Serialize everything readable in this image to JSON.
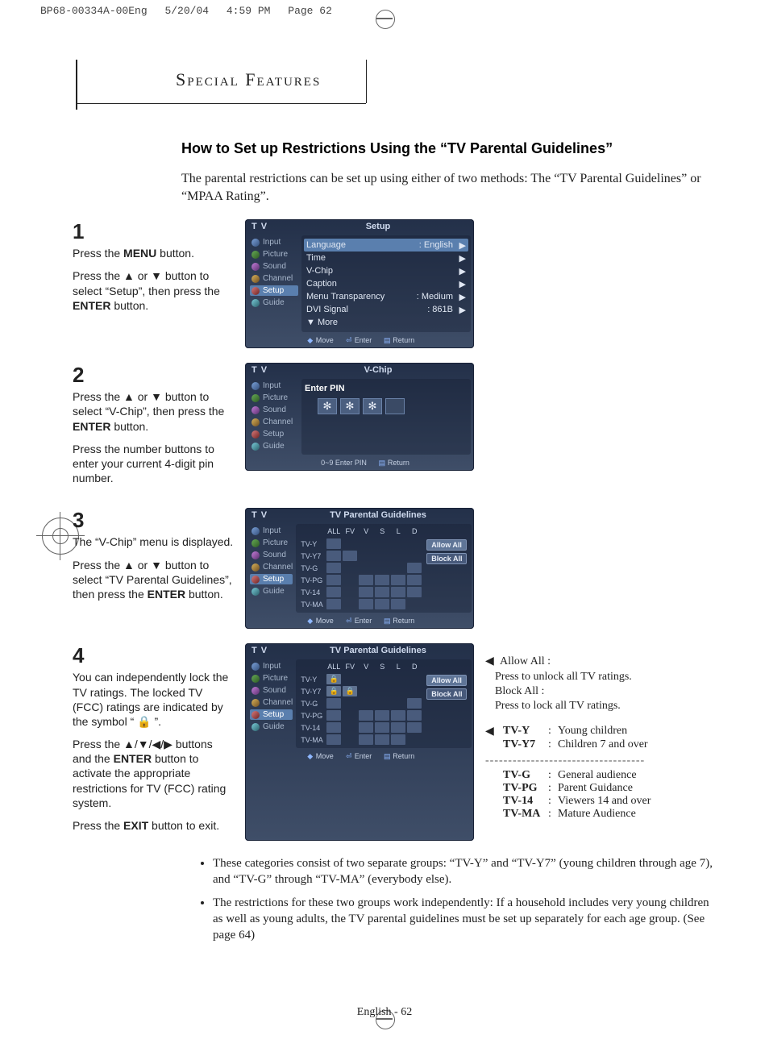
{
  "doc": {
    "id": "BP68-00334A-00Eng",
    "date": "5/20/04",
    "time": "4:59 PM",
    "page_crop": "Page 62"
  },
  "page": {
    "section": "Special Features",
    "title": "How to Set up Restrictions Using the “TV Parental Guidelines”",
    "intro": "The parental restrictions can be set up using either of two methods: The “TV Parental Guidelines” or “MPAA Rating”.",
    "pagenum": "English - 62"
  },
  "steps": [
    {
      "num": "1",
      "line1a": "Press the",
      "line1b": "MENU",
      "line1c": "button.",
      "line2": "Press the ▲ or ▼ button to select “Setup”, then press the",
      "line2b": "ENTER",
      "line2c": "button."
    },
    {
      "num": "2",
      "line1": "Press the ▲ or ▼ button to select “V-Chip”, then press the",
      "line1b": "ENTER",
      "line1c": "button.",
      "line2": "Press the number buttons to enter your current 4-digit pin number."
    },
    {
      "num": "3",
      "line1": "The “V-Chip” menu is displayed.",
      "line2": "Press the ▲ or ▼ button to select “TV Parental Guidelines”, then press the",
      "line2b": "ENTER",
      "line2c": "button."
    },
    {
      "num": "4",
      "line1": "You can independently lock the TV ratings. The locked TV (FCC) ratings are indicated by the symbol “ 🔒 ”.",
      "line2a": "Press the ▲/▼/◀/▶ buttons and the",
      "line2b": "ENTER",
      "line2c": "button to activate the appropriate restrictions for TV (FCC) rating system.",
      "line3a": "Press the",
      "line3b": "EXIT",
      "line3c": "button to exit."
    }
  ],
  "osd": {
    "tv": "T V",
    "setup_title": "Setup",
    "vchip_title": "V-Chip",
    "tpg_title": "TV Parental Guidelines",
    "enter_pin": "Enter PIN",
    "allow": "Allow All",
    "block": "Block All",
    "side": [
      "Input",
      "Picture",
      "Sound",
      "Channel",
      "Setup",
      "Guide"
    ],
    "setup_rows": [
      {
        "label": "Language",
        "value": ": English"
      },
      {
        "label": "Time"
      },
      {
        "label": "V-Chip"
      },
      {
        "label": "Caption"
      },
      {
        "label": "Menu Transparency",
        "value": ": Medium"
      },
      {
        "label": "DVI Signal",
        "value": ": 861B"
      },
      {
        "label": "▼ More"
      }
    ],
    "cols": [
      "ALL",
      "FV",
      "V",
      "S",
      "L",
      "D"
    ],
    "rows": [
      "TV-Y",
      "TV-Y7",
      "TV-G",
      "TV-PG",
      "TV-14",
      "TV-MA"
    ],
    "help": {
      "move": "Move",
      "enter": "Enter",
      "return": "Return",
      "pin": "0~9 Enter PIN"
    }
  },
  "notes": {
    "allow_head": "Allow All :",
    "allow_text": "Press to unlock all TV ratings.",
    "block_head": "Block All :",
    "block_text": "Press to lock all TV ratings."
  },
  "ratings": [
    {
      "code": "TV-Y",
      "desc": "Young children"
    },
    {
      "code": "TV-Y7",
      "desc": "Children 7 and over"
    },
    {
      "code": "TV-G",
      "desc": "General audience"
    },
    {
      "code": "TV-PG",
      "desc": "Parent Guidance"
    },
    {
      "code": "TV-14",
      "desc": "Viewers 14 and over"
    },
    {
      "code": "TV-MA",
      "desc": "Mature Audience"
    }
  ],
  "bullets": [
    "These categories consist of two separate groups: “TV-Y” and “TV-Y7” (young children through age 7), and “TV-G” through “TV-MA” (everybody else).",
    "The restrictions for these two groups work independently: If a household includes very young children as well as young adults, the TV parental guidelines must be set up separately for each age group. (See page 64)"
  ]
}
